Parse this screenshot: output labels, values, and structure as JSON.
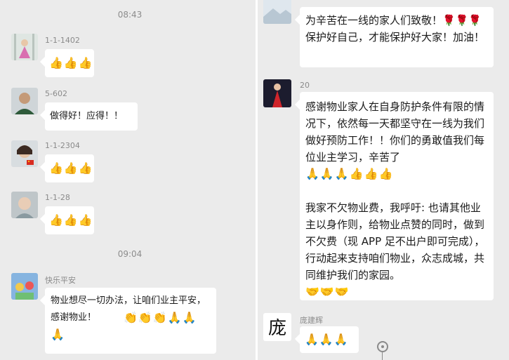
{
  "left_chat": {
    "timestamps": [
      "08:43",
      "09:04"
    ],
    "messages": [
      {
        "sender": "1-1-1402",
        "avatar": "girl-pink-dress-avatar",
        "emoji": "👍👍👍"
      },
      {
        "sender": "5-602",
        "avatar": "man-portrait-avatar",
        "text": "做得好！应得！！"
      },
      {
        "sender": "1-1-2304",
        "avatar": "woman-flag-avatar",
        "emoji": "👍👍👍"
      },
      {
        "sender": "1-1-28",
        "avatar": "baby-avatar",
        "emoji": "👍👍👍"
      },
      {
        "sender": "快乐平安",
        "avatar": "cartoon-avatar",
        "text": "物业想尽一切办法，让咱们业主平安，感谢物业！",
        "emoji_line1": "👏👏👏🙏🙏",
        "emoji_line2": "🙏"
      }
    ]
  },
  "right_chat": {
    "messages": [
      {
        "sender": "",
        "avatar": "landscape-avatar",
        "text": "为辛苦在一线的家人们致敬！🌹🌹🌹保护好自己，才能保护好大家！加油！"
      },
      {
        "sender": "20",
        "avatar": "red-dress-avatar",
        "text_part1": "感谢物业家人在自身防护条件有限的情况下，依然每一天都坚守在一线为我们做好预防工作！！你们的勇敢值我们每位业主学习，辛苦了",
        "emoji_part1": "🙏🙏🙏👍👍👍",
        "text_part2": "我家不欠物业费，我呼吁: 也请其他业主以身作则，给物业点赞的同时，做到不欠费（现 APP 足不出户即可完成），行动起来支持咱们物业，众志成城，共同维护我们的家园。",
        "emoji_part2": "🤝🤝🤝"
      },
      {
        "sender": "庞建辉",
        "avatar": "calligraphy-avatar",
        "avatar_text": "庞",
        "emoji": "🙏🙏🙏"
      }
    ]
  }
}
